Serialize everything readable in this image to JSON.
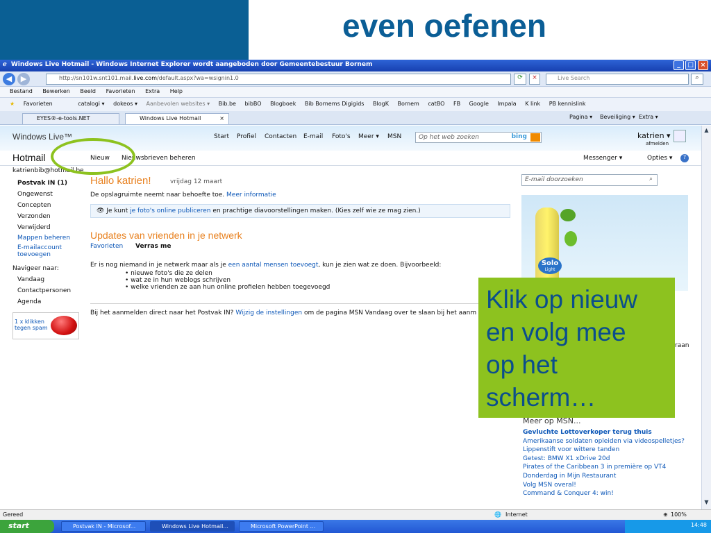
{
  "slide": {
    "title": "even oefenen"
  },
  "ie": {
    "window_title": "Windows Live Hotmail - Windows Internet Explorer wordt aangeboden door Gemeentebestuur Bornem",
    "address_prefix": "http://sn101w.snt101.mail.",
    "address_domain": "live.com",
    "address_suffix": "/default.aspx?wa=wsignin1.0",
    "search_placeholder": "Live Search",
    "menu": [
      "Bestand",
      "Bewerken",
      "Beeld",
      "Favorieten",
      "Extra",
      "Help"
    ],
    "favorites_label": "Favorieten",
    "favorites": [
      "catalogi ▾",
      "dokeos ▾",
      "Aanbevolen websites ▾",
      "Bib.be",
      "bibBO",
      "Blogboek",
      "Bib Bornems Digigids",
      "BlogK",
      "Bornem",
      "catBO",
      "FB",
      "Google",
      "Impala",
      "K link",
      "PB kennislink"
    ],
    "tabs": [
      "EYES®-e-tools.NET",
      "Windows Live Hotmail"
    ],
    "tab_tools": [
      "Pagina ▾",
      "Beveiliging ▾",
      "Extra ▾"
    ],
    "status_left": "Gereed",
    "status_zone": "Internet",
    "zoom": "100%"
  },
  "hotmail": {
    "brand": "Windows Live™",
    "top_nav": [
      "Start",
      "Profiel",
      "Contacten",
      "E-mail",
      "Foto's",
      "Meer ▾",
      "MSN"
    ],
    "web_search_placeholder": "Op het web zoeken",
    "bing": "bing",
    "user_name": "katrien ▾",
    "signout": "afmelden",
    "section_title": "Hotmail",
    "toolbar_new": "Nieuw",
    "toolbar_manage": "Nieuwsbrieven beheren",
    "messenger": "Messenger ▾",
    "options": "Opties ▾",
    "account": "katrienbib@hotmail.be",
    "folders": [
      "Postvak IN (1)",
      "Ongewenst",
      "Concepten",
      "Verzonden",
      "Verwijderd"
    ],
    "folder_links": [
      "Mappen beheren",
      "E-mailaccount toevoegen"
    ],
    "navigate_label": "Navigeer naar:",
    "navigate": [
      "Vandaag",
      "Contactpersonen",
      "Agenda"
    ],
    "spam_button": "1 x klikken tegen spam",
    "greeting": "Hallo katrien!",
    "date": "vrijdag 12 maart",
    "storage_text": "De opslagruimte neemt naar behoefte toe.",
    "storage_link": "Meer informatie",
    "tip_pre": "Je kunt",
    "tip_link": "je foto's online publiceren",
    "tip_post": "en prachtige diavoorstellingen maken. (Kies zelf wie ze mag zien.)",
    "updates_title": "Updates van vrienden in je netwerk",
    "filter_favorites": "Favorieten",
    "filter_surprise": "Verras me",
    "network_pre": "Er is nog niemand in je netwerk maar als je",
    "network_link": "een aantal mensen toevoegt",
    "network_post": ", kun je zien wat ze doen. Bijvoorbeeld:",
    "bullets": [
      "nieuwe foto's die ze delen",
      "wat ze in hun weblogs schrijven",
      "welke vrienden ze aan hun online profielen hebben toegevoegd"
    ],
    "footer_pre": "Bij het aanmelden direct naar het Postvak IN?",
    "footer_link": "Wijzig de instellingen",
    "footer_post": "om de pagina MSN Vandaag over te slaan bij het aanm",
    "mail_search_placeholder": "E-mail doorzoeken",
    "ad_brand": "Solo",
    "ad_sub": "Light",
    "right_fragment": "raan",
    "msn_title": "Meer op MSN...",
    "msn_headline": "Gevluchte Lottoverkoper terug thuis",
    "msn_links": [
      "Amerikaanse soldaten opleiden via videospelletjes?",
      "Lippenstift voor wittere tanden",
      "Getest: BMW X1 xDrive 20d",
      "Pirates of the Caribbean 3 in première op VT4",
      "Donderdag in Mijn Restaurant",
      "Volg MSN overal!",
      "Command & Conquer 4: win!"
    ]
  },
  "taskbar": {
    "start": "start",
    "tasks": [
      "Postvak IN - Microsof...",
      "Windows Live Hotmail...",
      "Microsoft PowerPoint ..."
    ],
    "clock": "14:48"
  },
  "overlay": {
    "text": "Klik op nieuw\nen volg mee\nop het\nscherm…"
  },
  "colors": {
    "slide_blue": "#0a5f94",
    "callout_green": "#8dc21f",
    "link": "#0b56b7",
    "heading_orange": "#e8801e"
  }
}
